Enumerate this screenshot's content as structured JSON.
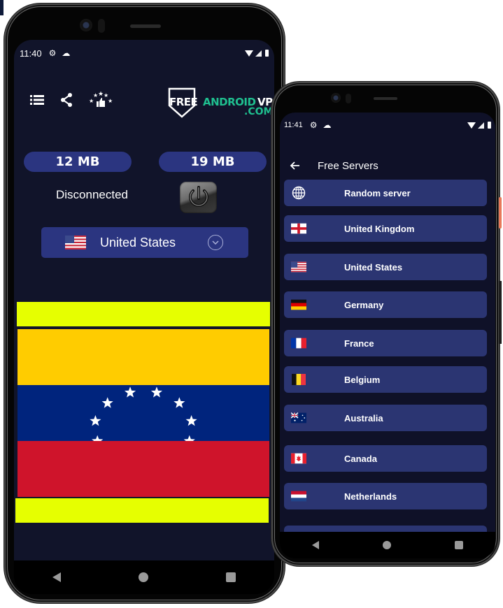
{
  "phone1": {
    "status_bar": {
      "time": "11:40",
      "icons": [
        "gear-icon",
        "cloud-icon"
      ],
      "right_icons": [
        "wifi-icon",
        "signal-icon",
        "battery-icon"
      ]
    },
    "toolbar": {
      "icons": [
        "menu-list-icon",
        "share-icon",
        "rate-stars-thumb-icon"
      ]
    },
    "logo": {
      "free": "FREE",
      "android": "ANDROID",
      "vpn": "VPN",
      "com": ".COM"
    },
    "traffic": {
      "download": "12 MB",
      "upload": "19 MB"
    },
    "connection_status": "Disconnected",
    "power_button": "power-icon",
    "selected_country": {
      "name": "United States",
      "flag": "us"
    },
    "banner": {
      "description": "Venezuela flag with yellow bars",
      "stars": 8,
      "colors": {
        "yellow_bar": "#e6ff00",
        "gold": "#ffcc00",
        "blue": "#00247d",
        "red": "#cf142b"
      }
    },
    "nav": {
      "back": "back-icon",
      "home": "home-icon",
      "recents": "recents-icon"
    }
  },
  "phone2": {
    "status_bar": {
      "time": "11:41",
      "icons": [
        "gear-icon",
        "cloud-icon"
      ],
      "right_icons": [
        "wifi-icon",
        "signal-icon",
        "battery-icon"
      ]
    },
    "app_bar": {
      "title": "Free Servers",
      "back_icon": "arrow-left-icon"
    },
    "servers": [
      {
        "label": "Random server",
        "icon": "globe"
      },
      {
        "label": "United Kingdom",
        "icon": "gb"
      },
      {
        "label": "United States",
        "icon": "us"
      },
      {
        "label": "Germany",
        "icon": "de"
      },
      {
        "label": "France",
        "icon": "fr"
      },
      {
        "label": "Belgium",
        "icon": "be"
      },
      {
        "label": "Australia",
        "icon": "au"
      },
      {
        "label": "Canada",
        "icon": "ca"
      },
      {
        "label": "Netherlands",
        "icon": "nl"
      }
    ],
    "nav": {
      "back": "back-icon",
      "home": "home-icon",
      "recents": "recents-icon"
    }
  },
  "colors": {
    "screen_bg": "#11142a",
    "accent": "#2b3580",
    "list_item": "#2b3572",
    "logo_green": "#1fbf8f"
  }
}
